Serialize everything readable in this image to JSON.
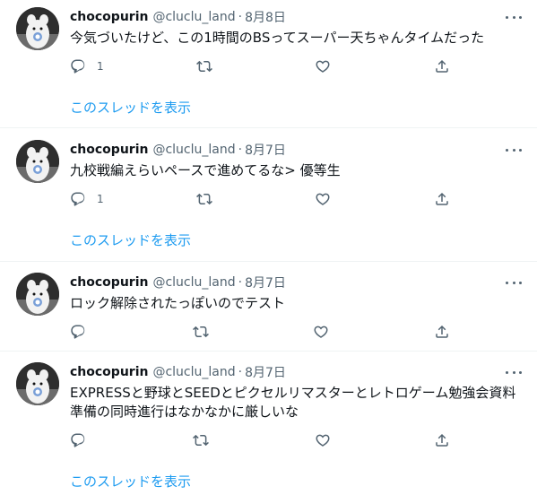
{
  "tweets": [
    {
      "name": "chocopurin",
      "handle": "@cluclu_land",
      "separator": "·",
      "date": "8月8日",
      "text": "今気づいたけど、この1時間のBSってスーパー天ちゃんタイムだった",
      "reply_count": "1",
      "thread_link": "このスレッドを表示"
    },
    {
      "name": "chocopurin",
      "handle": "@cluclu_land",
      "separator": "·",
      "date": "8月7日",
      "text": "九校戦編えらいペースで進めてるな> 優等生",
      "reply_count": "1",
      "thread_link": "このスレッドを表示"
    },
    {
      "name": "chocopurin",
      "handle": "@cluclu_land",
      "separator": "·",
      "date": "8月7日",
      "text": "ロック解除されたっぽいのでテスト",
      "reply_count": ""
    },
    {
      "name": "chocopurin",
      "handle": "@cluclu_land",
      "separator": "·",
      "date": "8月7日",
      "text": "EXPRESSと野球とSEEDとピクセルリマスターとレトロゲーム勉強会資料準備の同時進行はなかなかに厳しいな",
      "reply_count": "",
      "thread_link": "このスレッドを表示"
    }
  ],
  "icons": {
    "reply": "reply-icon",
    "retweet": "retweet-icon",
    "like": "heart-icon",
    "share": "share-icon",
    "more": "more-icon"
  },
  "colors": {
    "link": "#1d9bf0",
    "muted": "#536471",
    "text": "#0f1419",
    "divider": "#eff3f4"
  }
}
